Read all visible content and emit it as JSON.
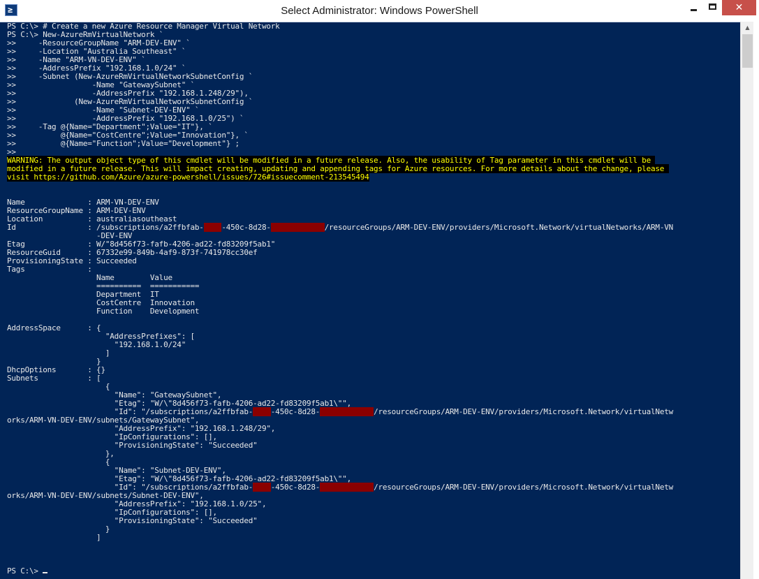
{
  "window": {
    "title": "Select Administrator: Windows PowerShell",
    "icon": "powershell-icon",
    "icon_glyph": "≥",
    "close_glyph": "✕"
  },
  "colors": {
    "console_background": "#012456",
    "console_text": "#e8e8e8",
    "warning_text": "#ffff00",
    "warning_background": "#000000",
    "redaction": "#8b0000",
    "close_button": "#c7504a"
  },
  "console": {
    "lines": [
      {
        "segs": [
          {
            "t": "PS C:\\> # Create a new Azure Resource Manager Virtual Network"
          }
        ]
      },
      {
        "segs": [
          {
            "t": "PS C:\\> New-AzureRmVirtualNetwork `"
          }
        ]
      },
      {
        "segs": [
          {
            "t": ">>     -ResourceGroupName \"ARM-DEV-ENV\" `"
          }
        ]
      },
      {
        "segs": [
          {
            "t": ">>     -Location \"Australia Southeast\" `"
          }
        ]
      },
      {
        "segs": [
          {
            "t": ">>     -Name \"ARM-VN-DEV-ENV\" `"
          }
        ]
      },
      {
        "segs": [
          {
            "t": ">>     -AddressPrefix \"192.168.1.0/24\" `"
          }
        ]
      },
      {
        "segs": [
          {
            "t": ">>     -Subnet (New-AzureRmVirtualNetworkSubnetConfig `"
          }
        ]
      },
      {
        "segs": [
          {
            "t": ">>                 -Name \"GatewaySubnet\" `"
          }
        ]
      },
      {
        "segs": [
          {
            "t": ">>                 -AddressPrefix \"192.168.1.248/29\"),"
          }
        ]
      },
      {
        "segs": [
          {
            "t": ">>             (New-AzureRmVirtualNetworkSubnetConfig `"
          }
        ]
      },
      {
        "segs": [
          {
            "t": ">>                 -Name \"Subnet-DEV-ENV\" `"
          }
        ]
      },
      {
        "segs": [
          {
            "t": ">>                 -AddressPrefix \"192.168.1.0/25\") `"
          }
        ]
      },
      {
        "segs": [
          {
            "t": ">>     -Tag @{Name=\"Department\";Value=\"IT\"}, `"
          }
        ]
      },
      {
        "segs": [
          {
            "t": ">>          @{Name=\"CostCentre\";Value=\"Innovation\"}, `"
          }
        ]
      },
      {
        "segs": [
          {
            "t": ">>          @{Name=\"Function\";Value=\"Development\"} ;"
          }
        ]
      },
      {
        "segs": [
          {
            "t": ">>"
          }
        ]
      },
      {
        "segs": [
          {
            "t": "WARNING: The output object type of this cmdlet will be modified in a future release. Also, the usability of Tag parameter in this cmdlet will be ",
            "c": "warn"
          }
        ]
      },
      {
        "segs": [
          {
            "t": "modified in a future release. This will impact creating, updating and appending tags for Azure resources. For more details about the change, please ",
            "c": "warn"
          }
        ]
      },
      {
        "segs": [
          {
            "t": "visit https://github.com/Azure/azure-powershell/issues/726#issuecomment-213545494",
            "c": "warn"
          }
        ]
      },
      {
        "segs": [
          {
            "t": ""
          }
        ]
      },
      {
        "segs": [
          {
            "t": ""
          }
        ]
      },
      {
        "segs": [
          {
            "t": "Name              : ARM-VN-DEV-ENV"
          }
        ]
      },
      {
        "segs": [
          {
            "t": "ResourceGroupName : ARM-DEV-ENV"
          }
        ]
      },
      {
        "segs": [
          {
            "t": "Location          : australiasoutheast"
          }
        ]
      },
      {
        "segs": [
          {
            "t": "Id                : /subscriptions/a2ffbfab-"
          },
          {
            "t": "xxxx",
            "c": "redact"
          },
          {
            "t": "-450c-8d28-"
          },
          {
            "t": "xxxxxxxxxxxx",
            "c": "redact"
          },
          {
            "t": "/resourceGroups/ARM-DEV-ENV/providers/Microsoft.Network/virtualNetworks/ARM-VN"
          }
        ]
      },
      {
        "segs": [
          {
            "t": "                    -DEV-ENV"
          }
        ]
      },
      {
        "segs": [
          {
            "t": "Etag              : W/\"8d456f73-fafb-4206-ad22-fd83209f5ab1\""
          }
        ]
      },
      {
        "segs": [
          {
            "t": "ResourceGuid      : 67332e99-849b-4af9-873f-741978cc30ef"
          }
        ]
      },
      {
        "segs": [
          {
            "t": "ProvisioningState : Succeeded"
          }
        ]
      },
      {
        "segs": [
          {
            "t": "Tags              :"
          }
        ]
      },
      {
        "segs": [
          {
            "t": "                    Name        Value"
          }
        ]
      },
      {
        "segs": [
          {
            "t": "                    ==========  ==========="
          }
        ]
      },
      {
        "segs": [
          {
            "t": "                    Department  IT"
          }
        ]
      },
      {
        "segs": [
          {
            "t": "                    CostCentre  Innovation"
          }
        ]
      },
      {
        "segs": [
          {
            "t": "                    Function    Development"
          }
        ]
      },
      {
        "segs": [
          {
            "t": ""
          }
        ]
      },
      {
        "segs": [
          {
            "t": "AddressSpace      : {"
          }
        ]
      },
      {
        "segs": [
          {
            "t": "                      \"AddressPrefixes\": ["
          }
        ]
      },
      {
        "segs": [
          {
            "t": "                        \"192.168.1.0/24\""
          }
        ]
      },
      {
        "segs": [
          {
            "t": "                      ]"
          }
        ]
      },
      {
        "segs": [
          {
            "t": "                    }"
          }
        ]
      },
      {
        "segs": [
          {
            "t": "DhcpOptions       : {}"
          }
        ]
      },
      {
        "segs": [
          {
            "t": "Subnets           : ["
          }
        ]
      },
      {
        "segs": [
          {
            "t": "                      {"
          }
        ]
      },
      {
        "segs": [
          {
            "t": "                        \"Name\": \"GatewaySubnet\","
          }
        ]
      },
      {
        "segs": [
          {
            "t": "                        \"Etag\": \"W/\\\"8d456f73-fafb-4206-ad22-fd83209f5ab1\\\"\","
          }
        ]
      },
      {
        "segs": [
          {
            "t": "                        \"Id\": \"/subscriptions/a2ffbfab-"
          },
          {
            "t": "xxxx",
            "c": "redact"
          },
          {
            "t": "-450c-8d28-"
          },
          {
            "t": "xxxxxxxxxxxx",
            "c": "redact"
          },
          {
            "t": "/resourceGroups/ARM-DEV-ENV/providers/Microsoft.Network/virtualNetw"
          }
        ]
      },
      {
        "segs": [
          {
            "t": "orks/ARM-VN-DEV-ENV/subnets/GatewaySubnet\","
          }
        ]
      },
      {
        "segs": [
          {
            "t": "                        \"AddressPrefix\": \"192.168.1.248/29\","
          }
        ]
      },
      {
        "segs": [
          {
            "t": "                        \"IpConfigurations\": [],"
          }
        ]
      },
      {
        "segs": [
          {
            "t": "                        \"ProvisioningState\": \"Succeeded\""
          }
        ]
      },
      {
        "segs": [
          {
            "t": "                      },"
          }
        ]
      },
      {
        "segs": [
          {
            "t": "                      {"
          }
        ]
      },
      {
        "segs": [
          {
            "t": "                        \"Name\": \"Subnet-DEV-ENV\","
          }
        ]
      },
      {
        "segs": [
          {
            "t": "                        \"Etag\": \"W/\\\"8d456f73-fafb-4206-ad22-fd83209f5ab1\\\"\","
          }
        ]
      },
      {
        "segs": [
          {
            "t": "                        \"Id\": \"/subscriptions/a2ffbfab-"
          },
          {
            "t": "xxxx",
            "c": "redact"
          },
          {
            "t": "-450c-8d28-"
          },
          {
            "t": "xxxxxxxxxxxx",
            "c": "redact"
          },
          {
            "t": "/resourceGroups/ARM-DEV-ENV/providers/Microsoft.Network/virtualNetw"
          }
        ]
      },
      {
        "segs": [
          {
            "t": "orks/ARM-VN-DEV-ENV/subnets/Subnet-DEV-ENV\","
          }
        ]
      },
      {
        "segs": [
          {
            "t": "                        \"AddressPrefix\": \"192.168.1.0/25\","
          }
        ]
      },
      {
        "segs": [
          {
            "t": "                        \"IpConfigurations\": [],"
          }
        ]
      },
      {
        "segs": [
          {
            "t": "                        \"ProvisioningState\": \"Succeeded\""
          }
        ]
      },
      {
        "segs": [
          {
            "t": "                      }"
          }
        ]
      },
      {
        "segs": [
          {
            "t": "                    ]"
          }
        ]
      },
      {
        "segs": [
          {
            "t": ""
          }
        ]
      },
      {
        "segs": [
          {
            "t": ""
          }
        ]
      },
      {
        "segs": [
          {
            "t": ""
          }
        ]
      },
      {
        "segs": [
          {
            "t": "PS C:\\> "
          }
        ],
        "cursor": true
      }
    ]
  }
}
